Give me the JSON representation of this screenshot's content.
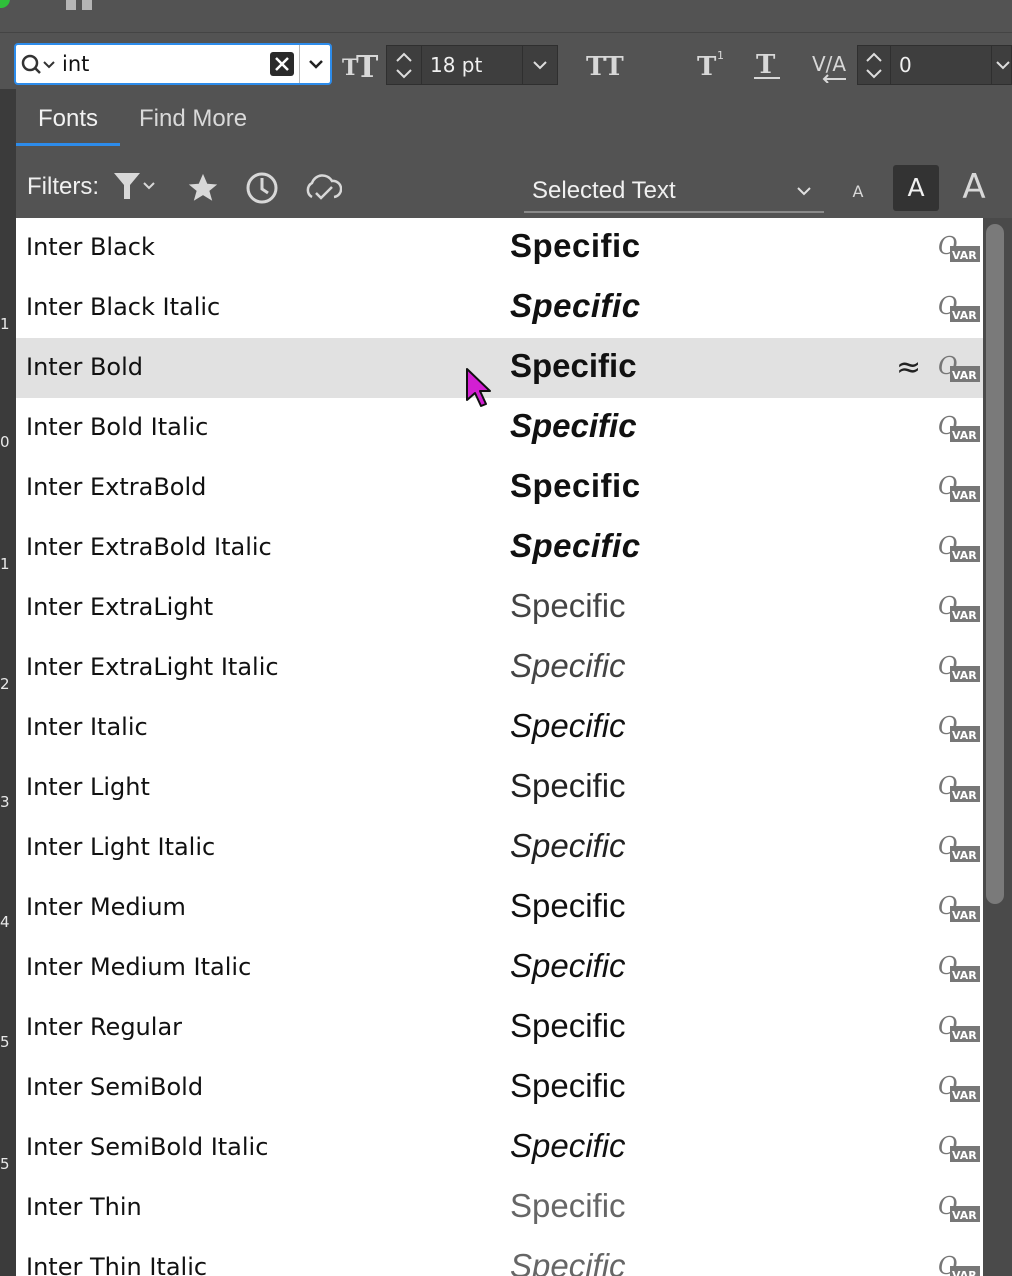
{
  "search": {
    "value": "int"
  },
  "toolbar": {
    "font_size": "18 pt",
    "tracking": "0"
  },
  "tabs": [
    {
      "label": "Fonts",
      "active": true
    },
    {
      "label": "Find More",
      "active": false
    }
  ],
  "filters": {
    "label": "Filters:",
    "preview_select": "Selected Text"
  },
  "sample_size_buttons": [
    "A",
    "A",
    "A"
  ],
  "fonts": [
    {
      "name": "Inter Black",
      "sample": "Specific",
      "weight": 900,
      "italic": false
    },
    {
      "name": "Inter Black Italic",
      "sample": "Specific",
      "weight": 900,
      "italic": true
    },
    {
      "name": "Inter Bold",
      "sample": "Specific",
      "weight": 700,
      "italic": false,
      "highlighted": true,
      "similar_icon": "≈"
    },
    {
      "name": "Inter Bold Italic",
      "sample": "Specific",
      "weight": 700,
      "italic": true
    },
    {
      "name": "Inter ExtraBold",
      "sample": "Specific",
      "weight": 800,
      "italic": false
    },
    {
      "name": "Inter ExtraBold Italic",
      "sample": "Specific",
      "weight": 800,
      "italic": true
    },
    {
      "name": "Inter ExtraLight",
      "sample": "Specific",
      "weight": 200,
      "italic": false
    },
    {
      "name": "Inter ExtraLight Italic",
      "sample": "Specific",
      "weight": 200,
      "italic": true
    },
    {
      "name": "Inter Italic",
      "sample": "Specific",
      "weight": 400,
      "italic": true
    },
    {
      "name": "Inter Light",
      "sample": "Specific",
      "weight": 300,
      "italic": false
    },
    {
      "name": "Inter Light Italic",
      "sample": "Specific",
      "weight": 300,
      "italic": true
    },
    {
      "name": "Inter Medium",
      "sample": "Specific",
      "weight": 500,
      "italic": false
    },
    {
      "name": "Inter Medium Italic",
      "sample": "Specific",
      "weight": 500,
      "italic": true
    },
    {
      "name": "Inter Regular",
      "sample": "Specific",
      "weight": 400,
      "italic": false
    },
    {
      "name": "Inter SemiBold",
      "sample": "Specific",
      "weight": 600,
      "italic": false
    },
    {
      "name": "Inter SemiBold Italic",
      "sample": "Specific",
      "weight": 600,
      "italic": true
    },
    {
      "name": "Inter Thin",
      "sample": "Specific",
      "weight": 100,
      "italic": false
    },
    {
      "name": "Inter Thin Italic",
      "sample": "Specific",
      "weight": 100,
      "italic": true
    }
  ],
  "ruler_numbers": [
    "1",
    "0",
    "1",
    "2",
    "3",
    "4",
    "5",
    "5"
  ],
  "var_badge": "VAR",
  "colors": {
    "accent": "#2d8ceb",
    "highlight_row": "#e1e1e1",
    "panel_bg": "#535353"
  }
}
